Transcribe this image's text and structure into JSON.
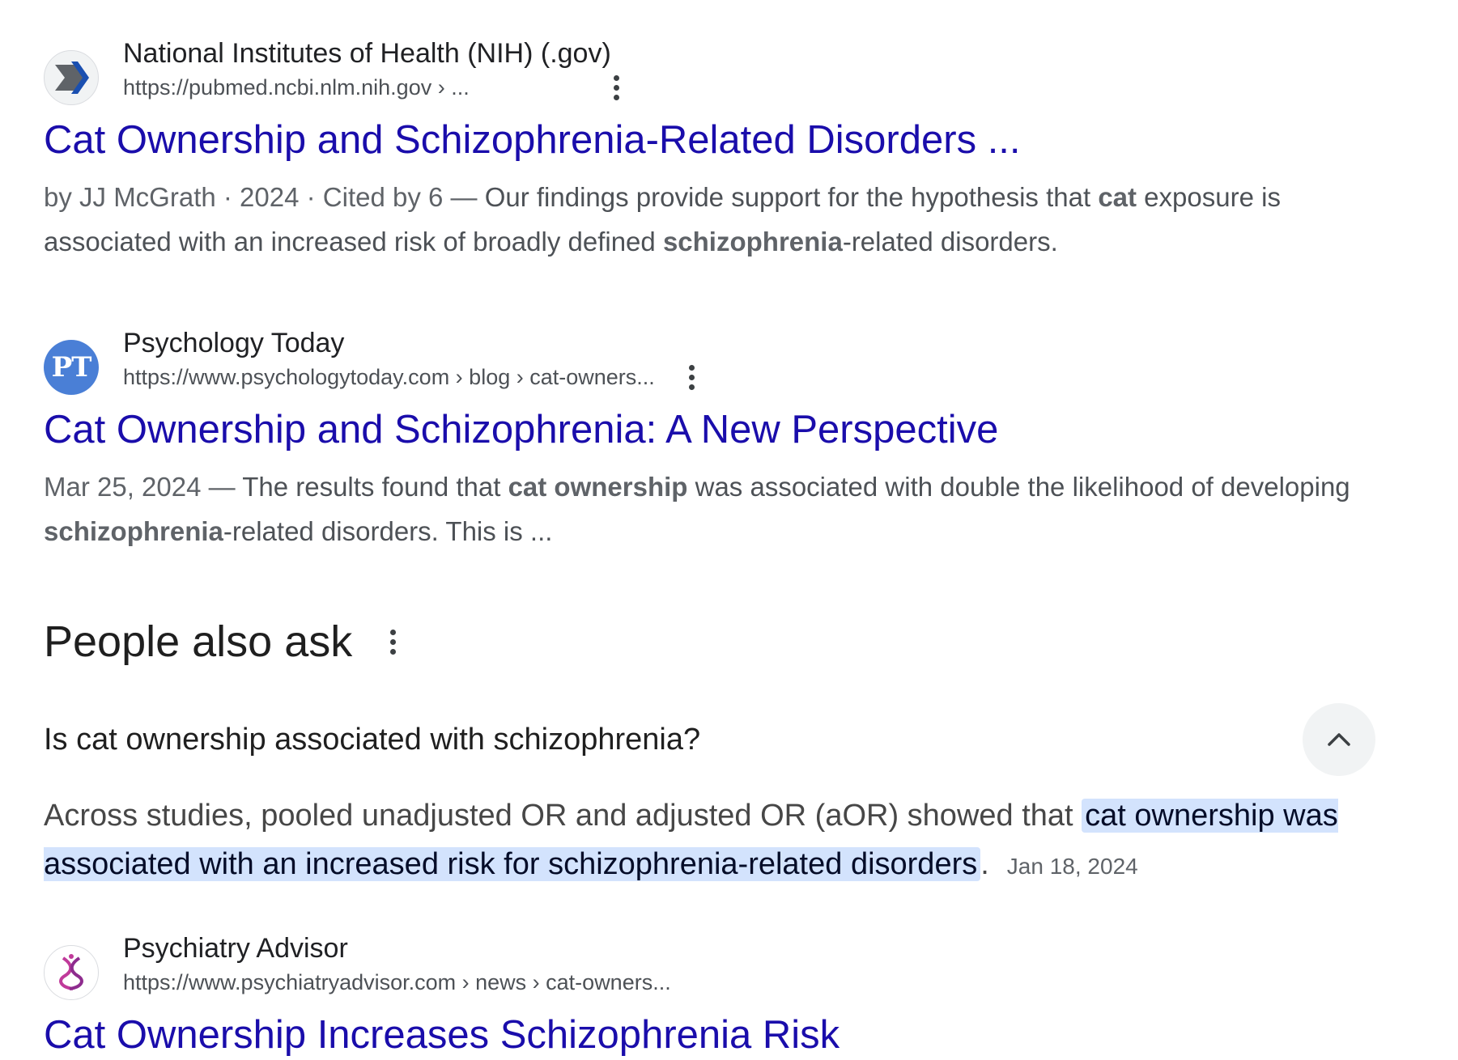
{
  "results": [
    {
      "site_name": "National Institutes of Health (NIH) (.gov)",
      "url": "https://pubmed.ncbi.nlm.nih.gov › ...",
      "favicon": "nih-chevron-icon",
      "title": "Cat Ownership and Schizophrenia-Related Disorders ...",
      "snippet": {
        "meta": "by JJ McGrath · 2024 · Cited by 6 — ",
        "parts": [
          {
            "text": "Our findings provide support for the hypothesis that ",
            "bold": false
          },
          {
            "text": "cat",
            "bold": true
          },
          {
            "text": " exposure is associated with an increased risk of broadly defined ",
            "bold": false
          },
          {
            "text": "schizophrenia",
            "bold": true
          },
          {
            "text": "-related disorders.",
            "bold": false
          }
        ]
      }
    },
    {
      "site_name": "Psychology Today",
      "url": "https://www.psychologytoday.com › blog › cat-owners...",
      "favicon": "pt-logo-icon",
      "favicon_text": "PT",
      "title": "Cat Ownership and Schizophrenia: A New Perspective",
      "snippet": {
        "meta": "Mar 25, 2024 — ",
        "parts": [
          {
            "text": "The results found that ",
            "bold": false
          },
          {
            "text": "cat ownership",
            "bold": true
          },
          {
            "text": " was associated with double the likelihood of developing ",
            "bold": false
          },
          {
            "text": "schizophrenia",
            "bold": true
          },
          {
            "text": "-related disorders. This is ...",
            "bold": false
          }
        ]
      }
    },
    {
      "site_name": "Psychiatry Advisor",
      "url": "https://www.psychiatryadvisor.com › news › cat-owners...",
      "favicon": "psychiatry-advisor-logo-icon",
      "title": "Cat Ownership Increases Schizophrenia Risk"
    }
  ],
  "people_also_ask": {
    "heading": "People also ask",
    "question": "Is cat ownership associated with schizophrenia?",
    "answer_prefix": "Across studies, pooled unadjusted OR and adjusted OR (aOR) showed that ",
    "answer_highlight": "cat ownership was associated with an increased risk for schizophrenia-related disorders",
    "answer_suffix": ".",
    "answer_date": "Jan 18, 2024"
  },
  "colors": {
    "link": "#1a0dab",
    "highlight": "#d3e3fd",
    "snippet_text": "#4d5156"
  }
}
